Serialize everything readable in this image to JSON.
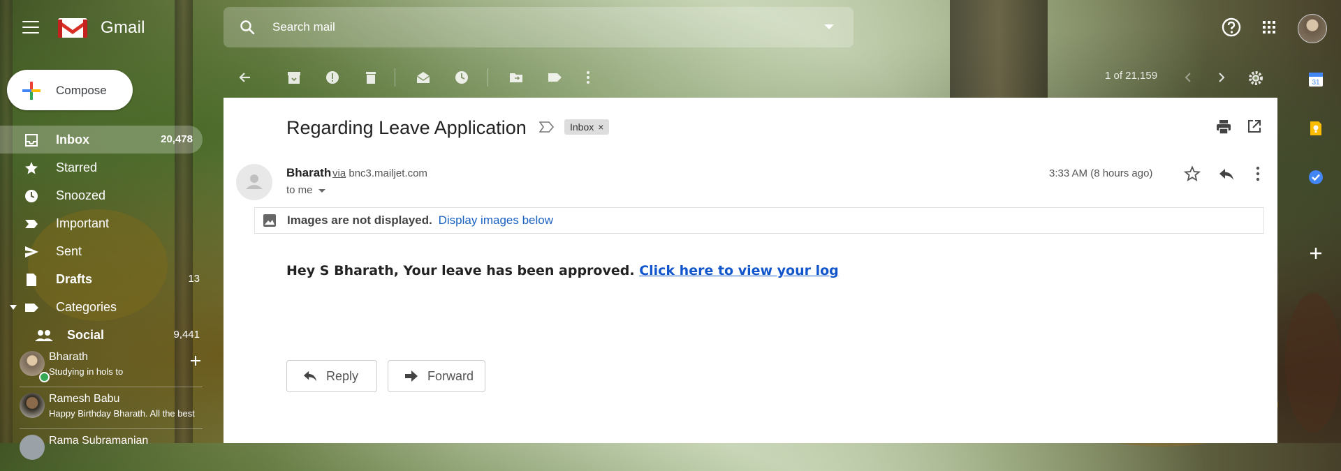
{
  "header": {
    "app_name": "Gmail",
    "search_placeholder": "Search mail"
  },
  "toolbar": {
    "pager": "1 of 21,159"
  },
  "sidebar": {
    "compose_label": "Compose",
    "items": [
      {
        "label": "Inbox",
        "count": "20,478",
        "icon": "inbox-icon",
        "active": true
      },
      {
        "label": "Starred",
        "count": "",
        "icon": "star-icon"
      },
      {
        "label": "Snoozed",
        "count": "",
        "icon": "clock-icon"
      },
      {
        "label": "Important",
        "count": "",
        "icon": "important-icon"
      },
      {
        "label": "Sent",
        "count": "",
        "icon": "send-icon"
      },
      {
        "label": "Drafts",
        "count": "13",
        "icon": "draft-icon",
        "bold": true
      },
      {
        "label": "Categories",
        "count": "",
        "icon": "label-icon"
      },
      {
        "label": "Social",
        "count": "9,441",
        "icon": "people-icon",
        "bold": true
      }
    ]
  },
  "hangouts": [
    {
      "name": "Bharath",
      "status": "Studying in hols to",
      "online": true
    },
    {
      "name": "Ramesh Babu",
      "status": "Happy Birthday Bharath. All the best"
    },
    {
      "name": "Rama Subramanian",
      "status": ""
    }
  ],
  "message": {
    "subject": "Regarding Leave Application",
    "label_chip": "Inbox",
    "sender_name": "Bharath",
    "via_word": "via",
    "via_domain": "bnc3.mailjet.com",
    "to": "to me",
    "time": "3:33 AM (8 hours ago)",
    "images_notice": "Images are not displayed.",
    "images_link": "Display images below",
    "body_text": "Hey S Bharath, Your leave has been approved.",
    "body_link": "Click here to view your log",
    "reply_label": "Reply",
    "forward_label": "Forward"
  },
  "colors": {
    "link": "#1155cc",
    "panel_bg": "#ffffff",
    "online": "#34a853"
  }
}
